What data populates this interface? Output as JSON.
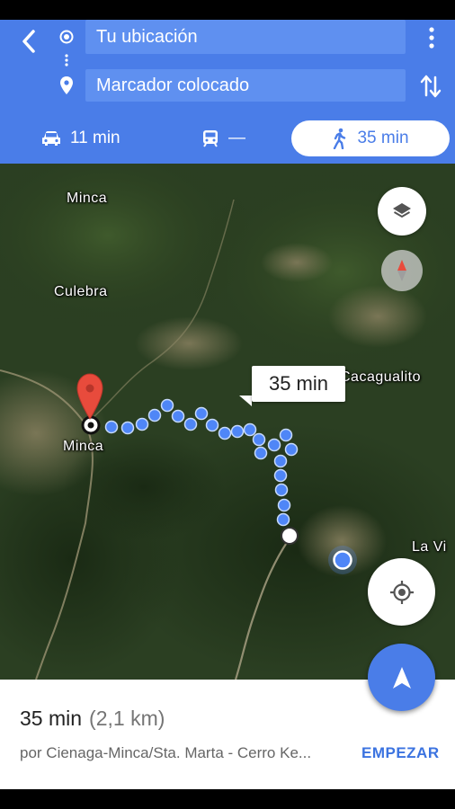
{
  "header": {
    "origin": "Tu ubicación",
    "destination": "Marcador colocado"
  },
  "modes": {
    "car": "11 min",
    "transit": "—",
    "walk": "35 min",
    "selected": "walk"
  },
  "map": {
    "places": {
      "minca_top": "Minca",
      "culebra": "Culebra",
      "cacagualito": "Cacagualito",
      "minca_pin": "Minca",
      "la_vi": "La Vi"
    },
    "route_bubble": "35 min"
  },
  "sheet": {
    "duration": "35 min",
    "distance": "(2,1 km)",
    "via": "por Cienaga-Minca/Sta. Marta - Cerro Ke...",
    "start_button": "EMPEZAR"
  },
  "colors": {
    "accent": "#4a7de8",
    "route": "#4f86f7",
    "pin": "#e84b3c"
  },
  "icons": [
    "back-icon",
    "origin-icon",
    "destination-pin-icon",
    "more-icon",
    "swap-icon",
    "car-icon",
    "transit-icon",
    "walk-icon",
    "layers-icon",
    "compass-icon",
    "my-location-icon",
    "navigation-icon"
  ]
}
